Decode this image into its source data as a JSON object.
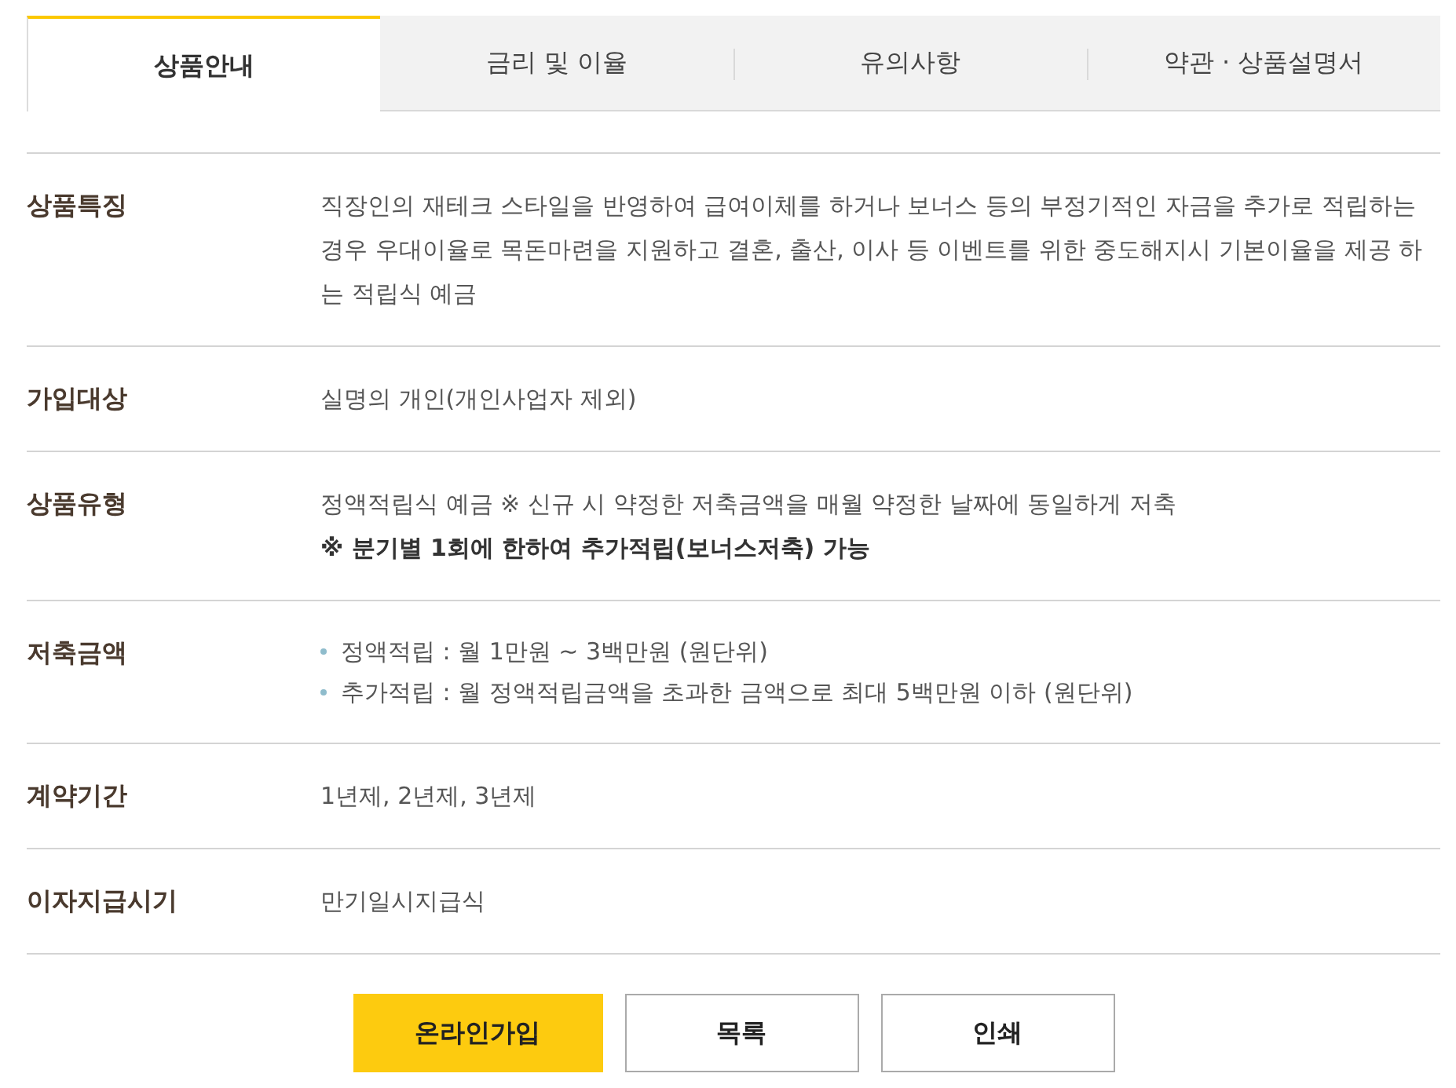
{
  "tabs": [
    {
      "label": "상품안내",
      "selected": true
    },
    {
      "label": "금리 및 이율",
      "selected": false
    },
    {
      "label": "유의사항",
      "selected": false
    },
    {
      "label": "약관 · 상품설명서",
      "selected": false
    }
  ],
  "rows": [
    {
      "label": "상품특징",
      "kind": "paragraph",
      "text": "직장인의 재테크 스타일을 반영하여 급여이체를 하거나 보너스 등의 부정기적인 자금을 추가로 적립하는 경우 우대이율로 목돈마련을 지원하고 결혼, 출산, 이사 등 이벤트를 위한 중도해지시 기본이율을 제공 하는 적립식 예금"
    },
    {
      "label": "가입대상",
      "kind": "paragraph",
      "text": "실명의 개인(개인사업자 제외)"
    },
    {
      "label": "상품유형",
      "kind": "lines",
      "lines": [
        {
          "text": "정액적립식 예금 ※ 신규 시 약정한 저축금액을 매월 약정한 날짜에 동일하게 저축",
          "bold": false
        },
        {
          "text": "※ 분기별 1회에 한하여 추가적립(보너스저축) 가능",
          "bold": true
        }
      ]
    },
    {
      "label": "저축금액",
      "kind": "bullets",
      "items": [
        "정액적립 : 월 1만원 ~ 3백만원 (원단위)",
        "추가적립 : 월 정액적립금액을 초과한 금액으로 최대 5백만원 이하 (원단위)"
      ]
    },
    {
      "label": "계약기간",
      "kind": "paragraph",
      "text": "1년제, 2년제, 3년제"
    },
    {
      "label": "이자지급시기",
      "kind": "paragraph",
      "text": "만기일시지급식"
    }
  ],
  "buttons": [
    {
      "label": "온라인가입",
      "kind": "primary"
    },
    {
      "label": "목록",
      "kind": "secondary"
    },
    {
      "label": "인쇄",
      "kind": "secondary"
    }
  ]
}
